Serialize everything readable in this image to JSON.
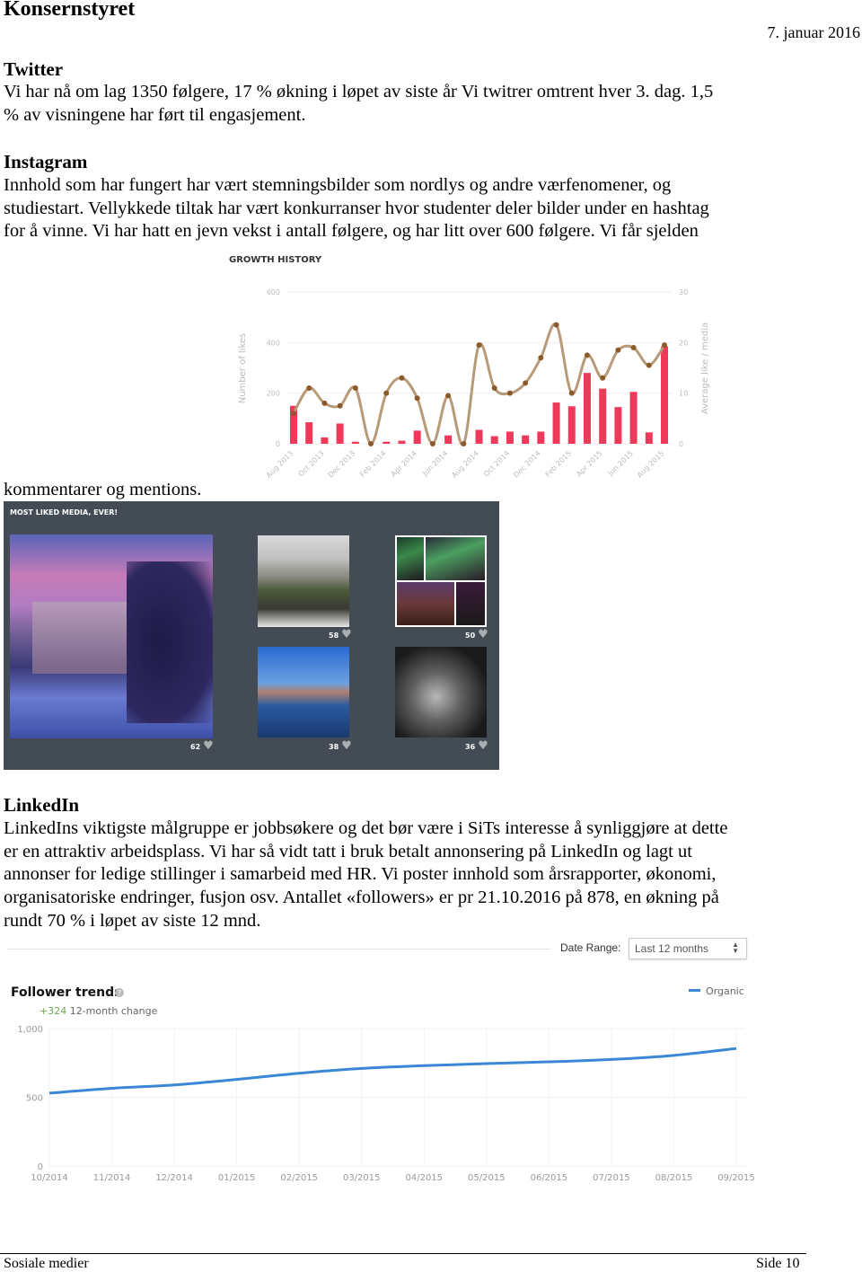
{
  "header": {
    "title": "Konsernstyret",
    "date": "7. januar 2016"
  },
  "twitter": {
    "heading": "Twitter",
    "lines": [
      "Vi har nå om lag 1350 følgere, 17 % økning i løpet av siste år Vi twitrer omtrent hver 3. dag. 1,5",
      "% av visningene har ført til engasjement."
    ]
  },
  "instagram": {
    "heading": "Instagram",
    "lines": [
      "Innhold som har fungert har vært stemningsbilder som nordlys og andre værfenomener, og",
      "studiestart. Vellykkede tiltak har vært konkurranser hvor studenter deler bilder under en hashtag",
      "for å vinne. Vi har hatt en jevn vekst i antall følgere, og har litt over 600 følgere. Vi får sjelden"
    ],
    "continuation": "kommentarer og mentions."
  },
  "chart_data": [
    {
      "type": "bar+line",
      "title": "GROWTH HISTORY",
      "ylabel": "Number of likes",
      "y2label": "Average like / media",
      "ylim": [
        0,
        600
      ],
      "y2lim": [
        0,
        30
      ],
      "yticks": [
        0,
        200,
        400,
        600
      ],
      "y2ticks": [
        0,
        10,
        20,
        30
      ],
      "grid": true,
      "categories": [
        "Aug 2013",
        "Sep 2013",
        "Oct 2013",
        "Nov 2013",
        "Dec 2013",
        "Jan 2014",
        "Feb 2014",
        "Mar 2014",
        "Apr 2014",
        "May 2014",
        "Jun 2014",
        "Jul 2014",
        "Aug 2014",
        "Sep 2014",
        "Oct 2014",
        "Nov 2014",
        "Dec 2014",
        "Jan 2015",
        "Feb 2015",
        "Mar 2015",
        "Apr 2015",
        "May 2015",
        "Jun 2015",
        "Jul 2015",
        "Aug 2015"
      ],
      "xtick_labels": [
        "Aug 2013",
        "Oct 2013",
        "Dec 2013",
        "Feb 2014",
        "Apr 2014",
        "Jun 2014",
        "Aug 2014",
        "Oct 2014",
        "Dec 2014",
        "Feb 2015",
        "Apr 2015",
        "Jun 2015",
        "Aug 2015"
      ],
      "series": [
        {
          "kind": "bar",
          "axis": "left",
          "color": "#f0395a",
          "values": [
            150,
            85,
            25,
            80,
            8,
            0,
            8,
            12,
            52,
            0,
            33,
            0,
            55,
            30,
            48,
            33,
            48,
            163,
            148,
            280,
            218,
            145,
            205,
            45,
            385
          ]
        },
        {
          "kind": "line",
          "axis": "right",
          "color": "#b89a78",
          "marker_color": "#8a5a2b",
          "values": [
            6,
            11,
            8,
            7.5,
            11,
            0,
            10,
            13,
            9,
            0,
            9.5,
            0,
            19.5,
            11,
            10,
            12,
            17,
            23.5,
            10,
            17.5,
            13,
            18.5,
            19,
            15.5,
            19.5
          ]
        }
      ]
    },
    {
      "type": "line",
      "title": "Follower trends",
      "legend": "top-right",
      "ylim": [
        0,
        1000
      ],
      "yticks": [
        "0",
        "500",
        "1,000"
      ],
      "grid": true,
      "categories": [
        "10/2014",
        "11/2014",
        "12/2014",
        "01/2015",
        "02/2015",
        "03/2015",
        "04/2015",
        "05/2015",
        "06/2015",
        "07/2015",
        "08/2015",
        "09/2015"
      ],
      "series": [
        {
          "name": "Organic",
          "color": "#3a87d6",
          "values": [
            530,
            565,
            590,
            630,
            675,
            710,
            730,
            745,
            758,
            775,
            805,
            855
          ]
        }
      ]
    }
  ],
  "most_liked": {
    "title": "MOST LIKED MEDIA, EVER!",
    "items": [
      {
        "likes": "62",
        "subject": "university building at dusk"
      },
      {
        "likes": "58",
        "subject": "crowd in front of building"
      },
      {
        "likes": "50",
        "subject": "northern lights collage"
      },
      {
        "likes": "38",
        "subject": "river with wharf houses"
      },
      {
        "likes": "36",
        "subject": "moon behind clouds"
      }
    ],
    "heart_icon": "heart-icon"
  },
  "linkedin": {
    "heading": "LinkedIn",
    "lines": [
      "LinkedIns viktigste målgruppe er jobbsøkere og det bør være i SiTs interesse å synliggjøre at dette",
      "er en attraktiv arbeidsplass. Vi har så vidt tatt i bruk betalt annonsering på LinkedIn og lagt ut",
      "annonser for ledige stillinger i samarbeid med HR. Vi poster innhold som årsrapporter, økonomi,",
      "organisatoriske endringer, fusjon osv. Antallet «followers» er pr 21.10.2016 på 878, en økning på",
      "rundt 70 % i løpet av siste 12 mnd."
    ],
    "date_range_label": "Date Range:",
    "date_range_value": "Last 12 months",
    "change_value": "+324",
    "change_label": "12-month change",
    "change_color": "#6aa84f"
  },
  "footer": {
    "left": "Sosiale medier",
    "right": "Side 10"
  }
}
